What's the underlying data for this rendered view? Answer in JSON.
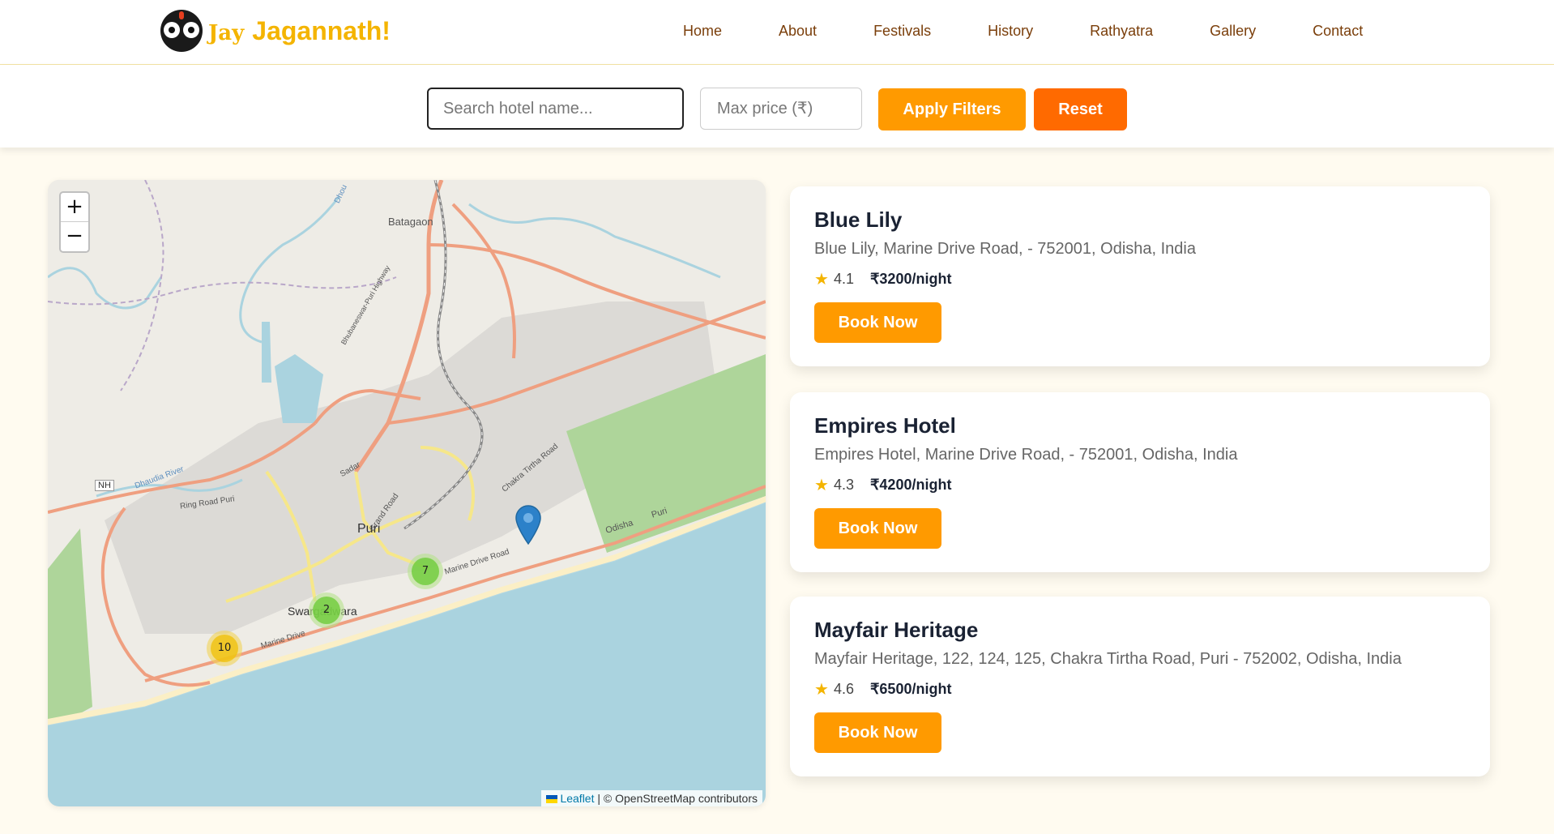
{
  "header": {
    "brand_prefix": "Jay",
    "brand_name": "Jagannath!",
    "nav": [
      "Home",
      "About",
      "Festivals",
      "History",
      "Rathyatra",
      "Gallery",
      "Contact"
    ]
  },
  "filters": {
    "search_placeholder": "Search hotel name...",
    "price_placeholder": "Max price (₹)",
    "apply_label": "Apply Filters",
    "reset_label": "Reset"
  },
  "map": {
    "zoom_in": "+",
    "zoom_out": "−",
    "labels": {
      "batagaon": "Batagaon",
      "puri": "Puri",
      "swargadwara": "Swargadwara",
      "nh": "NH",
      "ring_road": "Ring Road Puri",
      "grand_road": "Grand Road",
      "marine_drive_1": "Marine Drive Road",
      "marine_drive_2": "Marine Drive",
      "chakra_tirtha": "Chakra Tirtha Road",
      "odisha": "Odisha",
      "puri_2": "Puri",
      "dhaudia": "Dhaudia River",
      "sadar": "Sadar",
      "highway": "Bhubaneswar-Puri Highway",
      "dhou": "Dhou"
    },
    "clusters": [
      "10",
      "2",
      "7"
    ],
    "attribution_link": "Leaflet",
    "attribution_text": " | © OpenStreetMap contributors"
  },
  "hotels": [
    {
      "name": "Blue Lily",
      "address": "Blue Lily, Marine Drive Road, - 752001, Odisha, India",
      "rating": "4.1",
      "price": "₹3200/night",
      "cta": "Book Now"
    },
    {
      "name": "Empires Hotel",
      "address": "Empires Hotel, Marine Drive Road, - 752001, Odisha, India",
      "rating": "4.3",
      "price": "₹4200/night",
      "cta": "Book Now"
    },
    {
      "name": "Mayfair Heritage",
      "address": "Mayfair Heritage, 122, 124, 125, Chakra Tirtha Road, Puri - 752002, Odisha, India",
      "rating": "4.6",
      "price": "₹6500/night",
      "cta": "Book Now"
    }
  ],
  "colors": {
    "brand": "#f4b400",
    "accent": "#ff9a00",
    "reset": "#ff6a00",
    "nav_text": "#7a3e0a"
  }
}
